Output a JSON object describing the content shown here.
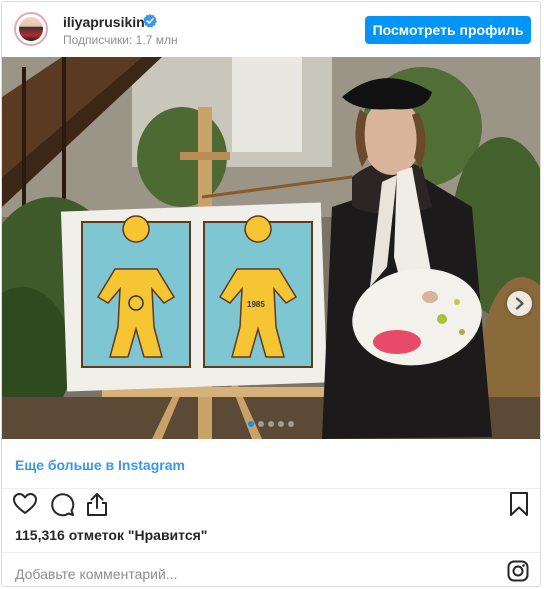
{
  "header": {
    "username": "iliyaprusikin",
    "followers": "Подписчики: 1.7 млн",
    "view_profile_label": "Посмотреть профиль"
  },
  "photo": {
    "painting_text_line1": "1985",
    "carousel_total": 5,
    "carousel_active_index": 0
  },
  "more_link": "Еще больше в Instagram",
  "likes": "115,316 отметок \"Нравится\"",
  "comment": {
    "placeholder": "Добавьте комментарий..."
  },
  "colors": {
    "accent": "#0095f6",
    "link": "#3897f0",
    "muted": "#8e8e8e",
    "text": "#262626"
  },
  "icons": [
    "verified-badge-icon",
    "chevron-right-icon",
    "heart-icon",
    "comment-icon",
    "share-icon",
    "bookmark-icon",
    "instagram-icon"
  ]
}
